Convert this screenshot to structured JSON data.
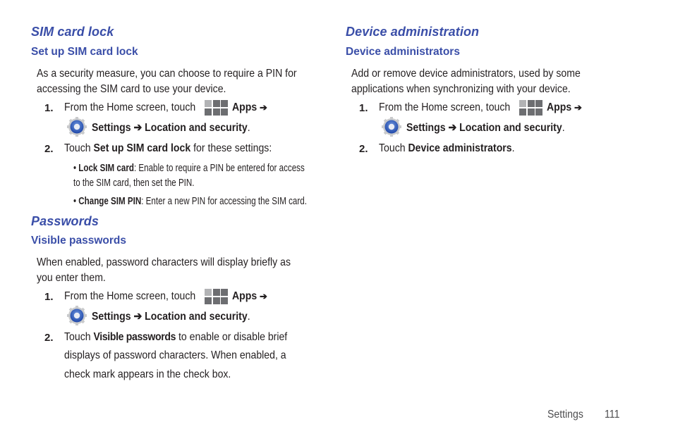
{
  "left": {
    "sim": {
      "title": "SIM card lock",
      "subtitle": "Set up SIM card lock",
      "intro_lines": [
        "As a security measure, you can choose to require a PIN for",
        "accessing the SIM card to use your device."
      ],
      "step1": {
        "num": "1.",
        "text": "From the Home screen, touch",
        "apps": "Apps",
        "arrow": "➔",
        "path": "Settings ➔ Location and security",
        "end": "."
      },
      "step2": {
        "num": "2.",
        "pre": "Touch ",
        "bold": "Set up SIM card lock",
        "post": " for these settings:"
      },
      "bullets": [
        {
          "mark": "•",
          "bold": "Lock SIM card",
          "text": ": Enable to require a PIN be entered for access",
          "cont": "to the SIM card, then set the PIN."
        },
        {
          "mark": "•",
          "bold": "Change SIM PIN",
          "text": ": Enter a new PIN for accessing the SIM card."
        }
      ]
    },
    "passwords": {
      "title": "Passwords",
      "subtitle": "Visible passwords",
      "intro_lines": [
        "When enabled, password characters will display briefly as",
        "you enter them."
      ],
      "step1": {
        "num": "1.",
        "text": "From the Home screen, touch",
        "apps": "Apps",
        "arrow": "➔",
        "path": "Settings ➔ Location and security",
        "end": "."
      },
      "step2": {
        "num": "2.",
        "pre": "Touch ",
        "bold": "Visible passwords",
        "post": " to enable or disable brief",
        "lines": [
          "displays of password characters. When enabled, a",
          "check mark appears in the check box."
        ]
      }
    }
  },
  "right": {
    "device": {
      "title": "Device administration",
      "subtitle": "Device administrators",
      "intro_lines": [
        "Add or remove device administrators, used by some",
        "applications when synchronizing with your device."
      ],
      "step1": {
        "num": "1.",
        "text": "From the Home screen, touch",
        "apps": "Apps",
        "arrow": "➔",
        "path": "Settings ➔ Location and security",
        "end": "."
      },
      "step2": {
        "num": "2.",
        "pre": "Touch ",
        "bold": "Device administrators",
        "post": "."
      }
    }
  },
  "footer": {
    "section": "Settings",
    "page": "111"
  },
  "icons": {
    "apps": "apps-grid-icon",
    "settings": "settings-gear-icon"
  },
  "colors": {
    "heading": "#3a4ea8",
    "text": "#231f20",
    "apps_dark": "#6d6e71",
    "apps_light": "#b2b3b5"
  }
}
